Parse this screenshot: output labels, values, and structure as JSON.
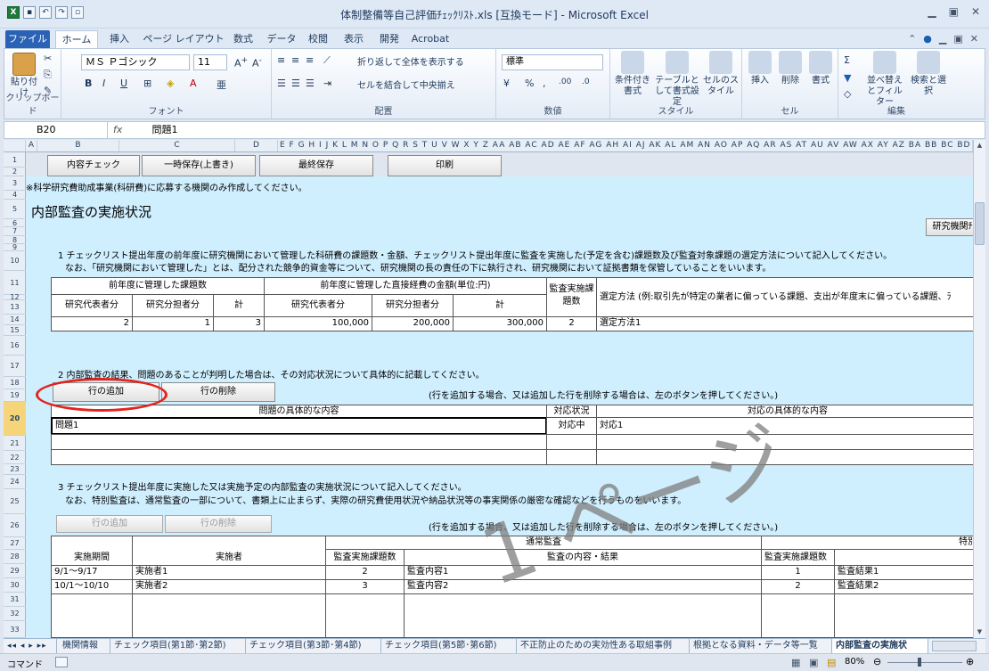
{
  "window": {
    "title": "体制整備等自己評価ﾁｪｯｸﾘｽﾄ.xls [互換モード] - Microsoft Excel"
  },
  "ribbon_tabs": [
    "ファイル",
    "ホーム",
    "挿入",
    "ページ レイアウト",
    "数式",
    "データ",
    "校閲",
    "表示",
    "開発",
    "Acrobat"
  ],
  "ribbon": {
    "clipboard": {
      "paste": "貼り付け",
      "label": "クリップボード"
    },
    "font": {
      "name": "ＭＳ Ｐゴシック",
      "size": "11",
      "label": "フォント"
    },
    "alignment": {
      "wrap": "折り返して全体を表示する",
      "merge": "セルを結合して中央揃え",
      "label": "配置"
    },
    "number": {
      "format": "標準",
      "label": "数値"
    },
    "styles": {
      "cond": "条件付き書式",
      "table": "テーブルとして書式設定",
      "cell": "セルのスタイル",
      "label": "スタイル"
    },
    "cells": {
      "insert": "挿入",
      "delete": "削除",
      "format": "書式",
      "label": "セル"
    },
    "editing": {
      "sort": "並べ替えとフィルター",
      "find": "検索と選択",
      "label": "編集"
    }
  },
  "formula_bar": {
    "name_box": "B20",
    "fx": "fx",
    "content": "問題1"
  },
  "col_headers": {
    "main": [
      "A",
      "B",
      "C",
      "D"
    ],
    "narrow": "E F G H I J K L M N O P Q R S T U V W X Y Z AA AB AC AD AE AF AG AH AI AJ AK AL AM AN AO AP AQ AR AS AT AU AV AW AX AY AZ BA BB BC BD BE BF BG"
  },
  "row_numbers": [
    "1",
    "2",
    "3",
    "4",
    "5",
    "6",
    "7",
    "8",
    "9",
    "10",
    "11",
    "12",
    "13",
    "14",
    "15",
    "16",
    "17",
    "18",
    "19",
    "20",
    "21",
    "22",
    "23",
    "24",
    "25",
    "26",
    "27",
    "28",
    "29",
    "30",
    "31",
    "32",
    "33"
  ],
  "sheet": {
    "buttons": {
      "check": "内容チェック",
      "temp_save": "一時保存(上書き)",
      "final_save": "最終保存",
      "print": "印刷"
    },
    "note": "※科学研究費助成事業(科研費)に応募する機関のみ作成してください。",
    "heading": "内部監査の実施状況",
    "right_btn": "研究機関ﾁ",
    "s1_line1": "1 チェックリスト提出年度の前年度に研究機関において管理した科研費の課題数・金額、チェックリスト提出年度に監査を実施した(予定を含む)課題数及び監査対象課題の選定方法について記入してください。",
    "s1_line2": "なお、「研究機関において管理した」とは、配分された競争的資金等について、研究機関の長の責任の下に執行され、研究機関において証拠書類を保管していることをいいます。",
    "t1": {
      "h_count": "前年度に管理した課題数",
      "h_amount": "前年度に管理した直接経費の金額(単位:円)",
      "h_audit": "監査実施課題数",
      "h_method": "選定方法 (例:取引先が特定の業者に偏っている課題、支出が年度末に偏っている課題、ﾗ",
      "sub": [
        "研究代表者分",
        "研究分担者分",
        "計",
        "研究代表者分",
        "研究分担者分",
        "計"
      ],
      "row": [
        "2",
        "1",
        "3",
        "100,000",
        "200,000",
        "300,000",
        "2",
        "選定方法1"
      ]
    },
    "s2": "2 内部監査の結果、問題のあることが判明した場合は、その対応状況について具体的に記載してください。",
    "add_row": "行の追加",
    "del_row": "行の削除",
    "row_hint": "(行を追加する場合、又は追加した行を削除する場合は、左のボタンを押してください。)",
    "t2": {
      "h_content": "問題の具体的な内容",
      "h_status": "対応状況",
      "h_detail": "対応の具体的な内容",
      "row": [
        "問題1",
        "対応中",
        "対応1"
      ]
    },
    "s3_line1": "3 チェックリスト提出年度に実施した又は実施予定の内部監査の実施状況について記入してください。",
    "s3_line2": "なお、特別監査は、通常監査の一部について、書類上に止まらず、実際の研究費使用状況や納品状況等の事実関係の厳密な確認などを行うものをいいます。",
    "t3": {
      "h_normal": "通常監査",
      "h_special": "特別",
      "h_period": "実施期間",
      "h_who": "実施者",
      "h_count": "監査実施課題数",
      "h_result": "監査の内容・結果",
      "h_count2": "監査実施課題数",
      "rows": [
        [
          "9/1～9/17",
          "実施者1",
          "2",
          "監査内容1",
          "1",
          "監査結果1"
        ],
        [
          "10/1～10/10",
          "実施者2",
          "3",
          "監査内容2",
          "2",
          "監査結果2"
        ]
      ]
    }
  },
  "watermark": "1 ページ",
  "sheet_tabs": [
    "機関情報",
    "チェック項目(第1節･第2節)",
    "チェック項目(第3節･第4節)",
    "チェック項目(第5節･第6節)",
    "不正防止のための実効性ある取組事例",
    "根拠となる資料・データ等一覧",
    "内部監査の実施状"
  ],
  "status": {
    "mode": "コマンド",
    "zoom": "80%"
  }
}
